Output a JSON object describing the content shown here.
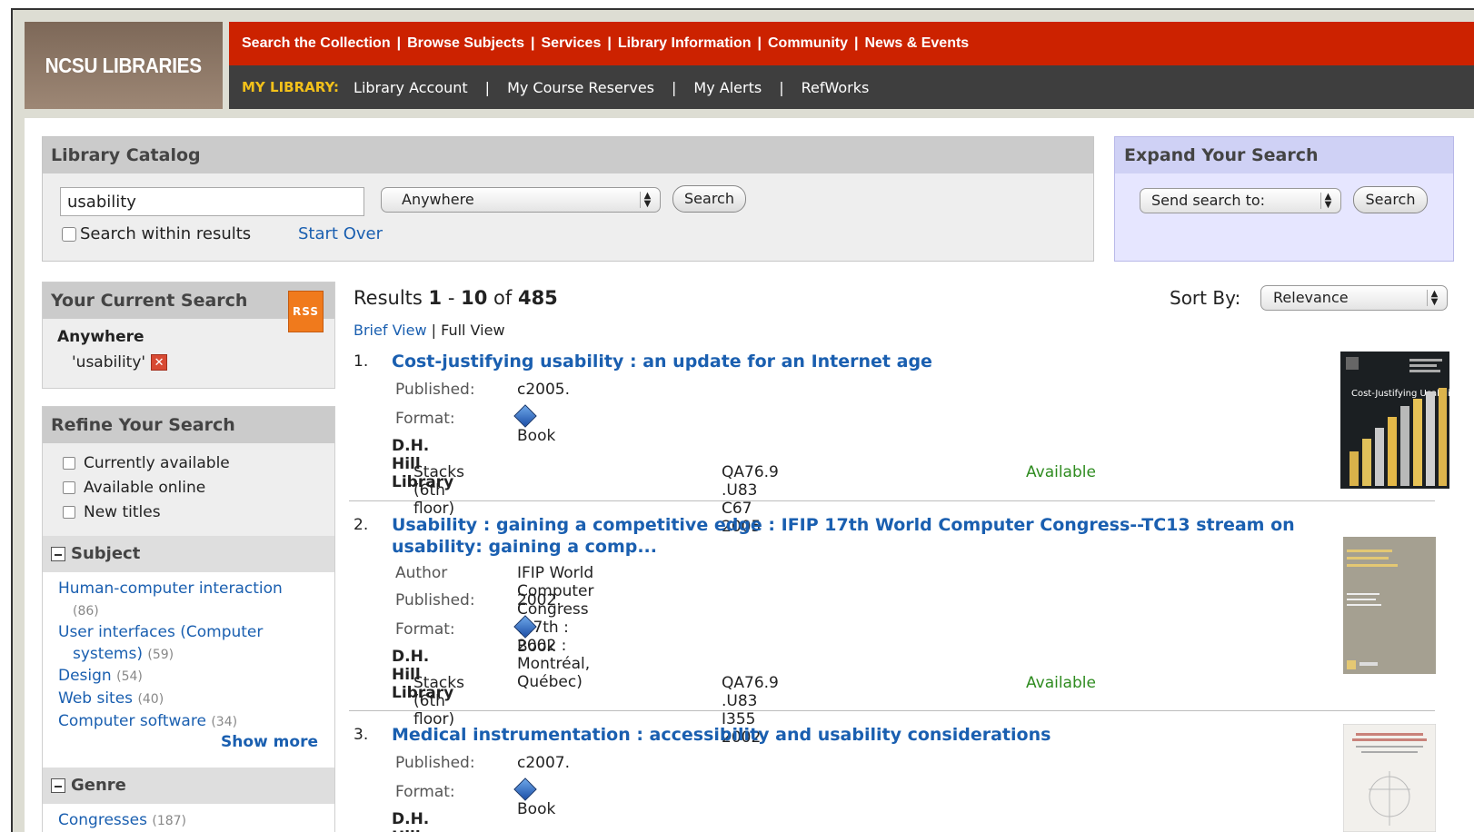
{
  "header": {
    "logo": "NCSU LIBRARIES",
    "top_nav": [
      "Search the Collection",
      "Browse Subjects",
      "Services",
      "Library Information",
      "Community",
      "News & Events"
    ],
    "my_library_label": "MY LIBRARY:",
    "my_nav": [
      "Library Account",
      "My Course Reserves",
      "My Alerts",
      "RefWorks"
    ]
  },
  "catalog": {
    "title": "Library Catalog",
    "query": "usability",
    "scope": "Anywhere",
    "search_label": "Search",
    "within_results_label": "Search within results",
    "start_over_label": "Start Over"
  },
  "expand": {
    "title": "Expand Your Search",
    "send_to": "Send search to:",
    "search_label": "Search"
  },
  "current_search": {
    "title": "Your Current Search",
    "rss_label": "RSS",
    "field": "Anywhere",
    "term": "'usability'"
  },
  "refine": {
    "title": "Refine Your Search",
    "options": [
      "Currently available",
      "Available online",
      "New titles"
    ],
    "subject_title": "Subject",
    "subjects": [
      {
        "label": "Human-computer interaction",
        "count": "(86)"
      },
      {
        "label": "User interfaces (Computer",
        "label2": "systems)",
        "count": "(59)"
      },
      {
        "label": "Design",
        "count": "(54)"
      },
      {
        "label": "Web sites",
        "count": "(40)"
      },
      {
        "label": "Computer software",
        "count": "(34)"
      }
    ],
    "show_more": "Show more",
    "genre_title": "Genre",
    "genres": [
      {
        "label": "Congresses",
        "count": "(187)"
      }
    ]
  },
  "results": {
    "prefix": "Results",
    "start": "1",
    "dash": "-",
    "end": "10",
    "of": "of",
    "total": "485",
    "brief_view": "Brief View",
    "full_view": "Full View",
    "sort_label": "Sort By:",
    "sort_value": "Relevance",
    "labels": {
      "author": "Author",
      "published": "Published:",
      "format": "Format:"
    },
    "items": [
      {
        "num": "1.",
        "title": "Cost-justifying usability : an update for an Internet age",
        "published": "c2005.",
        "format": "Book",
        "library": "D.H. Hill Library",
        "location": "Stacks (6th floor)",
        "call_number": "QA76.9 .U83 C67 2005",
        "status": "Available",
        "cover_title": "Cost-Justifying Usability"
      },
      {
        "num": "2.",
        "title": "Usability : gaining a competitive edge : IFIP 17th World Computer Congress--TC13 stream on usability: gaining a comp...",
        "author": "IFIP World Computer Congress (17th : 2002 : Montréal, Québec)",
        "published": "2002.",
        "format": "Book",
        "library": "D.H. Hill Library",
        "location": "Stacks (6th floor)",
        "call_number": "QA76.9 .U83 I355 2002",
        "status": "Available"
      },
      {
        "num": "3.",
        "title": "Medical instrumentation : accessibility and usability considerations",
        "published": "c2007.",
        "format": "Book",
        "library": "D.H. Hill Library"
      }
    ]
  },
  "colors": {
    "nav_red": "#cc2200",
    "nav_dark": "#3e3e3e",
    "link_blue": "#1a5fb0",
    "available_green": "#2e8b1f",
    "my_library_gold": "#f3c11a"
  }
}
